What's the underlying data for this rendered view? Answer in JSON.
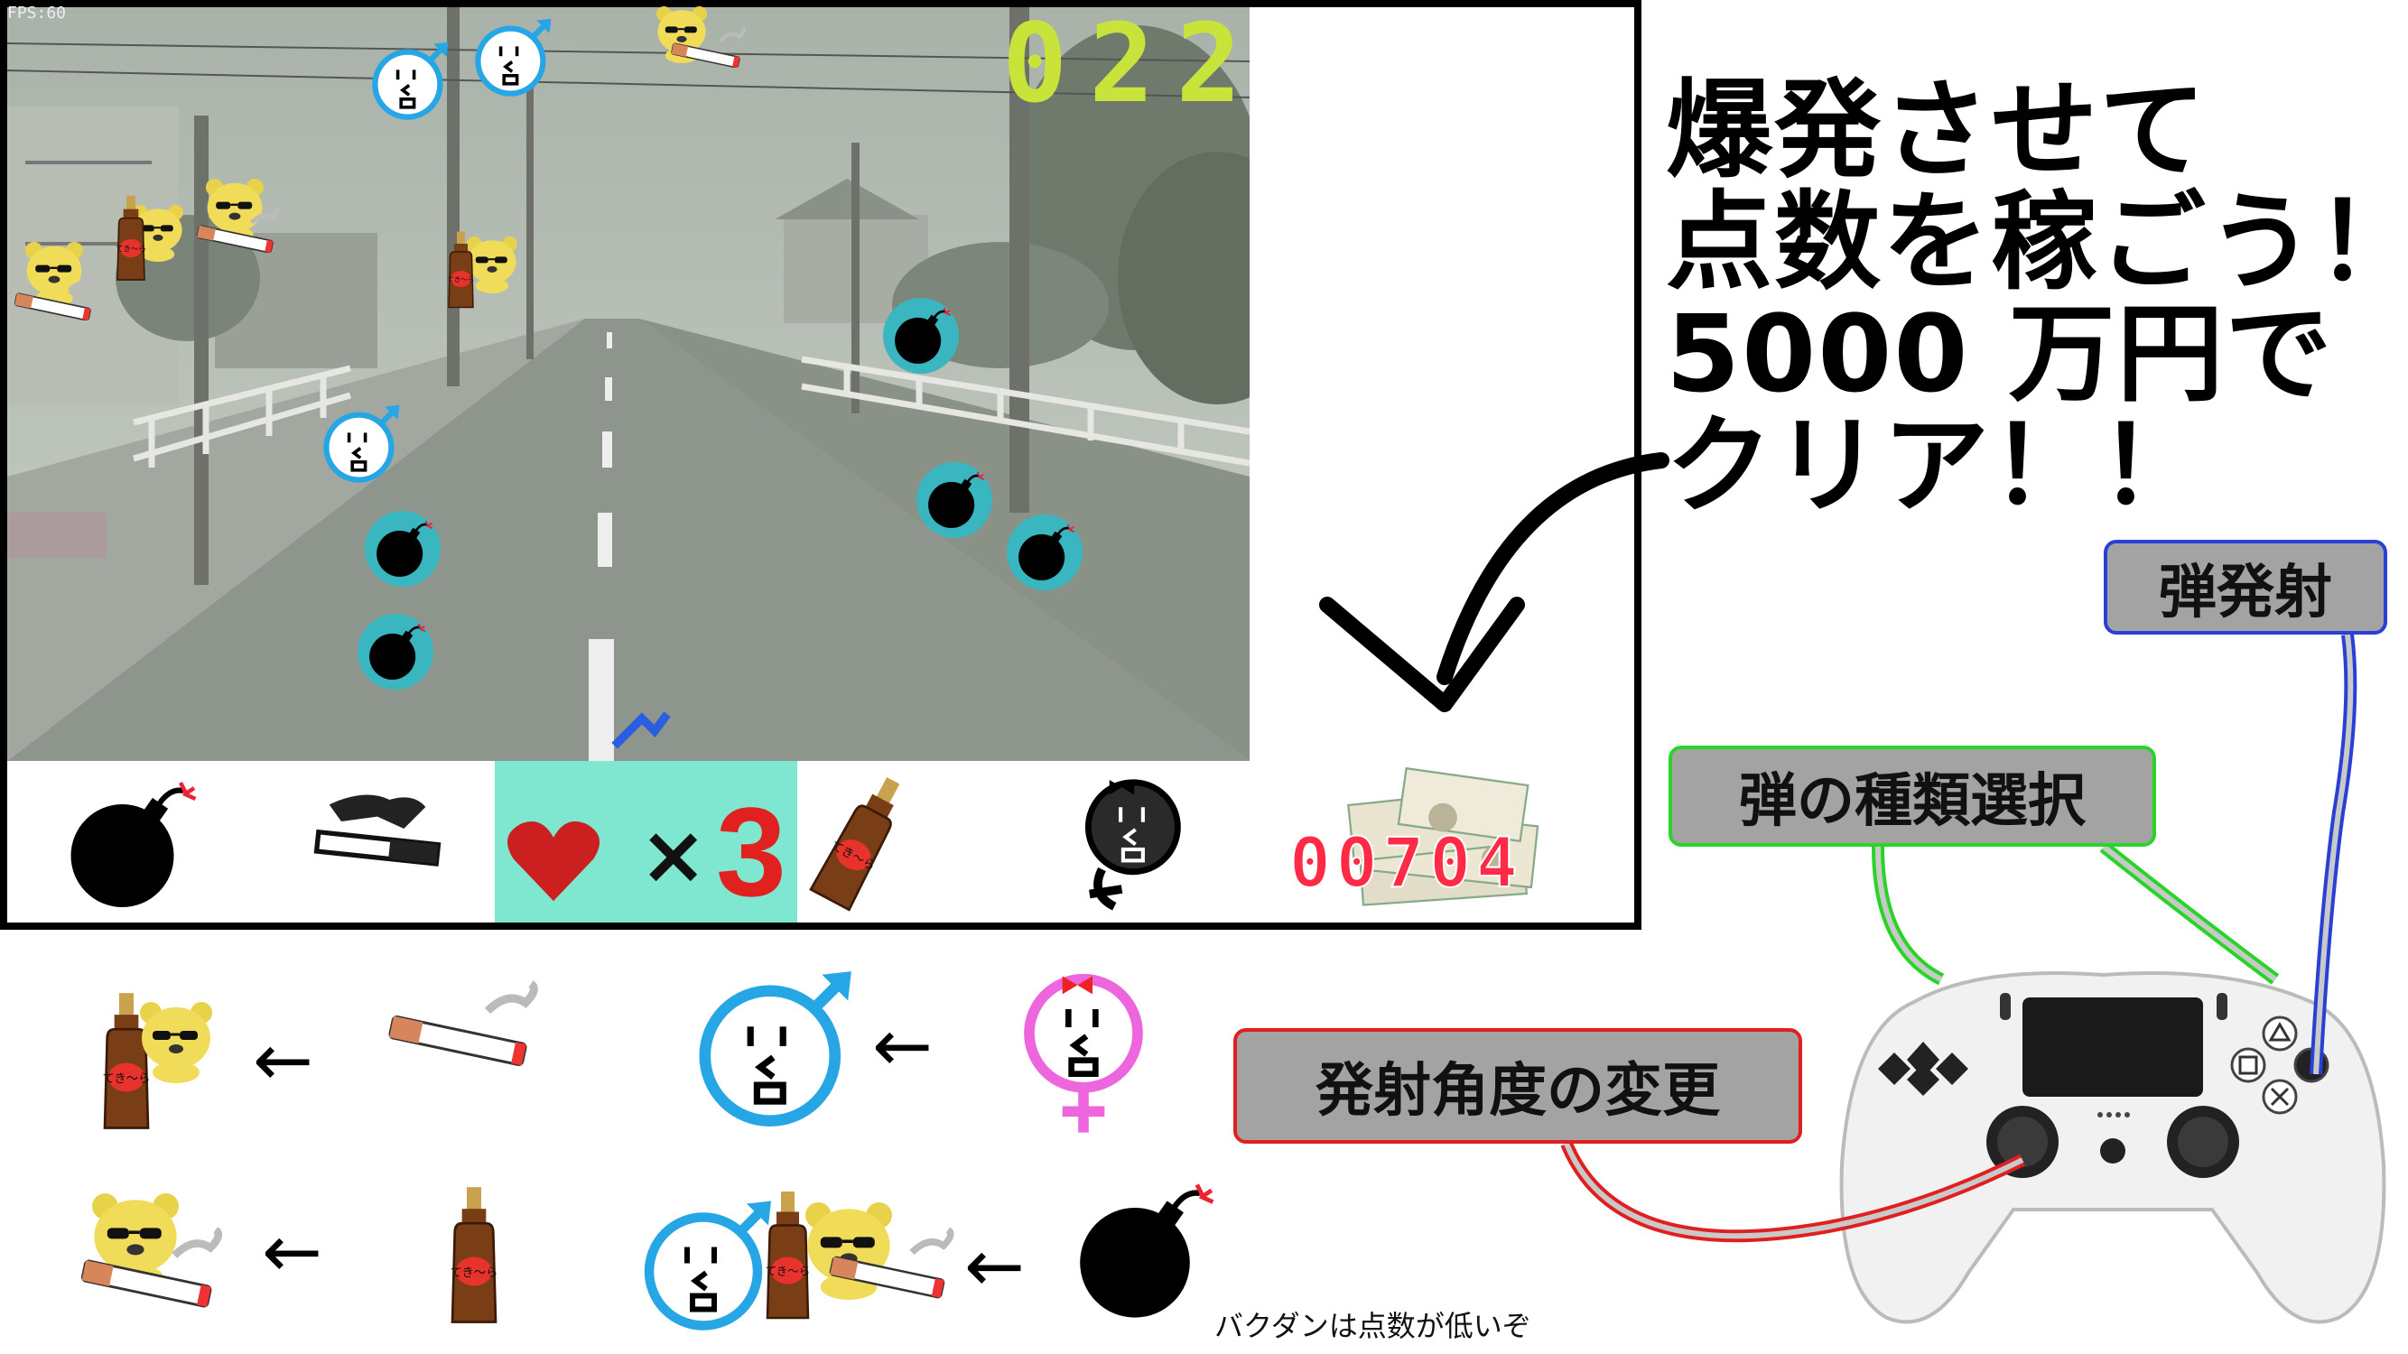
{
  "game": {
    "fps": "FPS:60",
    "timer": "022",
    "lives_prefix": "×",
    "lives": "3",
    "money": "00704"
  },
  "hud_slots": [
    {
      "icon": "bomb-icon"
    },
    {
      "icon": "cigarette-icon"
    },
    {
      "icon": "heart-icon"
    },
    {
      "icon": "whiskey-bottle-icon"
    },
    {
      "icon": "female-face-icon"
    },
    {
      "icon": "money-stack-icon"
    }
  ],
  "instruction": {
    "line1": "爆発させて",
    "line2": "点数を稼ごう！",
    "line3": "5000 万円で",
    "line4": "クリア！！"
  },
  "controls": {
    "fire": "弾発射",
    "select": "弾の種類選択",
    "angle": "発射角度の変更"
  },
  "legend": {
    "caption": "バクダンは点数が低いぞ",
    "arrow": "←"
  },
  "colors": {
    "timer": "#c8e43a",
    "lives": "#e12020",
    "money": "#ff2a45",
    "heart_box": "#7fe6cf",
    "fire_border": "#2a3fd6",
    "select_border": "#28d428",
    "angle_border": "#e02020"
  }
}
